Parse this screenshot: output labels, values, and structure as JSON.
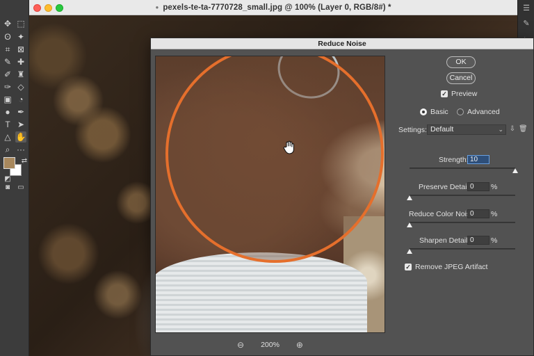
{
  "window": {
    "title": "pexels-te-ta-7770728_small.jpg @ 100% (Layer 0, RGB/8#) *",
    "modified_dot": "●"
  },
  "toolbar": {
    "tools": [
      {
        "name": "move-tool-icon",
        "glyph": "✥"
      },
      {
        "name": "marquee-tool-icon",
        "glyph": "⬚"
      },
      {
        "name": "lasso-tool-icon",
        "glyph": "ʘ"
      },
      {
        "name": "magic-wand-icon",
        "glyph": "✦"
      },
      {
        "name": "crop-tool-icon",
        "glyph": "⌗"
      },
      {
        "name": "frame-tool-icon",
        "glyph": "⊠"
      },
      {
        "name": "eyedropper-icon",
        "glyph": "✎"
      },
      {
        "name": "healing-brush-icon",
        "glyph": "✚"
      },
      {
        "name": "brush-tool-icon",
        "glyph": "✐"
      },
      {
        "name": "stamp-tool-icon",
        "glyph": "♜"
      },
      {
        "name": "history-brush-icon",
        "glyph": "✑"
      },
      {
        "name": "eraser-icon",
        "glyph": "◇"
      },
      {
        "name": "gradient-tool-icon",
        "glyph": "▣"
      },
      {
        "name": "blur-tool-icon",
        "glyph": "◔"
      },
      {
        "name": "dodge-tool-icon",
        "glyph": "●"
      },
      {
        "name": "pen-tool-icon",
        "glyph": "✒"
      },
      {
        "name": "type-tool-icon",
        "glyph": "T"
      },
      {
        "name": "path-select-icon",
        "glyph": "➤"
      },
      {
        "name": "shape-tool-icon",
        "glyph": "△"
      },
      {
        "name": "hand-tool-icon",
        "glyph": "✋"
      },
      {
        "name": "zoom-tool-icon",
        "glyph": "⌕"
      },
      {
        "name": "more-tools-icon",
        "glyph": "···"
      }
    ],
    "foreground_color": "#a8885d",
    "background_color": "#ffffff"
  },
  "dialog": {
    "title": "Reduce Noise",
    "ok_label": "OK",
    "cancel_label": "Cancel",
    "preview_label": "Preview",
    "preview_checked": true,
    "mode_basic_label": "Basic",
    "mode_advanced_label": "Advanced",
    "mode_selected": "Basic",
    "settings_label": "Settings:",
    "settings_value": "Default",
    "zoom_out_icon": "zoom-out-icon",
    "zoom_level": "200%",
    "zoom_in_icon": "zoom-in-icon",
    "controls": {
      "strength": {
        "label": "Strength:",
        "value": "10",
        "fraction": 1.0
      },
      "preserve_details": {
        "label": "Preserve Details:",
        "value": "0",
        "unit": "%",
        "fraction": 0.0
      },
      "reduce_color_noise": {
        "label": "Reduce Color Noise:",
        "value": "0",
        "unit": "%",
        "fraction": 0.0
      },
      "sharpen_details": {
        "label": "Sharpen Details:",
        "value": "0",
        "unit": "%",
        "fraction": 0.0
      }
    },
    "remove_jpeg_label": "Remove JPEG Artifact",
    "remove_jpeg_checked": true
  },
  "annotation": {
    "loupe_color": "#e56f2c"
  }
}
